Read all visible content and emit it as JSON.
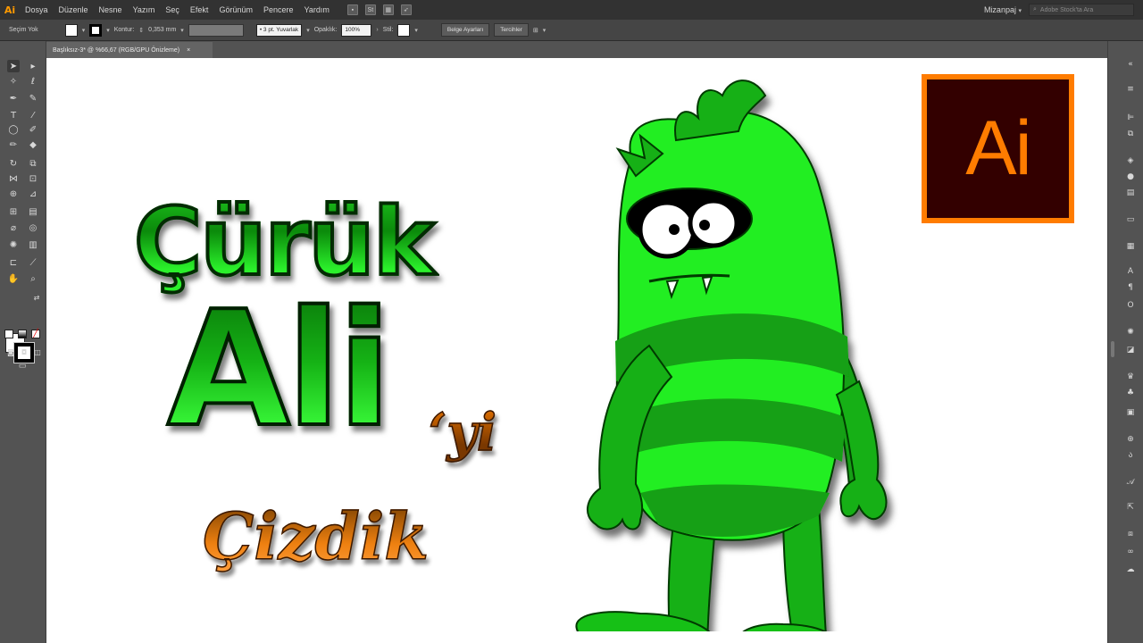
{
  "app": {
    "logo": "Ai"
  },
  "menu": [
    "Dosya",
    "Düzenle",
    "Nesne",
    "Yazım",
    "Seç",
    "Efekt",
    "Görünüm",
    "Pencere",
    "Yardım"
  ],
  "menubar_right": {
    "workspace": "Mizanpaj",
    "stock_search_placeholder": "Adobe Stock'ta Ara"
  },
  "control_bar": {
    "selection": "Seçim Yok",
    "stroke_label": "Kontur:",
    "stroke_value": "0,353 mm",
    "brush": "3 pt. Yuvarlak",
    "opacity_label": "Opaklık:",
    "opacity_value": "100%",
    "style_label": "Stil:",
    "doc_setup": "Belge Ayarları",
    "preferences": "Tercihler"
  },
  "document_tab": {
    "title": "Başlıksız-3* @ %66,67 (RGB/GPU Önizleme)",
    "close": "×"
  },
  "artwork": {
    "line1": "Çürük",
    "line2": "Ali",
    "line2_suffix": "‘yi",
    "line3": "Çizdik",
    "ai_logo_text": "Ai"
  },
  "colors": {
    "accent_orange": "#ff7c00",
    "monster_green": "#22ee22",
    "monster_dark_green": "#12a012"
  }
}
